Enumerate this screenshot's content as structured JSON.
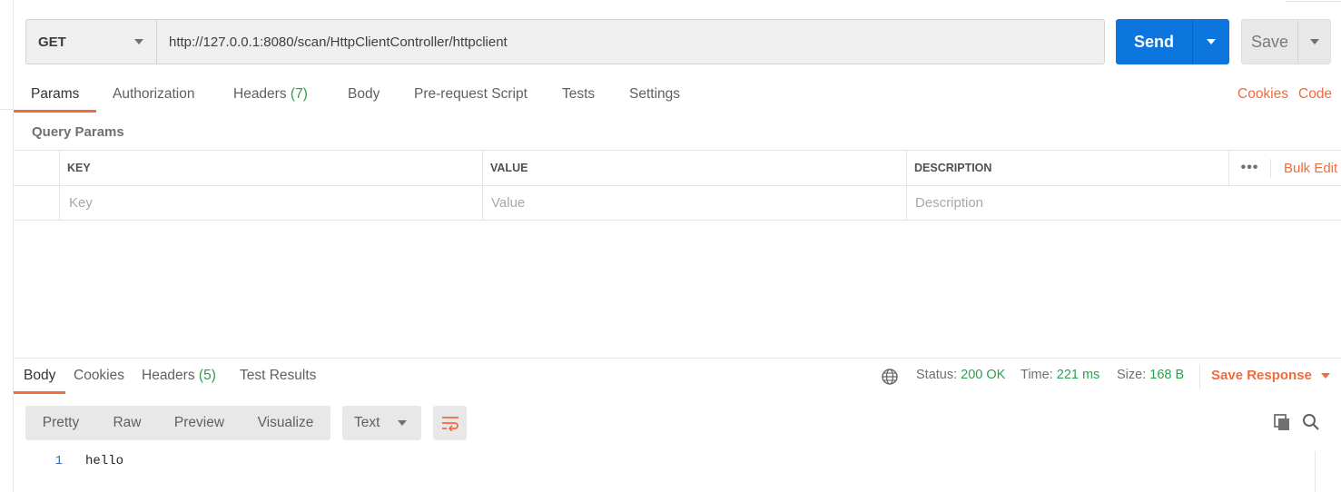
{
  "request": {
    "method": "GET",
    "url": "http://127.0.0.1:8080/scan/HttpClientController/httpclient",
    "send_label": "Send",
    "save_label": "Save"
  },
  "request_tabs": {
    "params": "Params",
    "authorization": "Authorization",
    "headers": "Headers",
    "headers_count": "(7)",
    "body": "Body",
    "prerequest": "Pre-request Script",
    "tests": "Tests",
    "settings": "Settings",
    "cookies_link": "Cookies",
    "code_link": "Code"
  },
  "query_params": {
    "title": "Query Params",
    "columns": [
      "KEY",
      "VALUE",
      "DESCRIPTION"
    ],
    "more_label": "•••",
    "bulk_edit": "Bulk Edit",
    "placeholders": [
      "Key",
      "Value",
      "Description"
    ]
  },
  "response": {
    "tabs": {
      "body": "Body",
      "cookies": "Cookies",
      "headers": "Headers",
      "headers_count": "(5)",
      "test_results": "Test Results"
    },
    "status_label": "Status:",
    "status_value": "200 OK",
    "time_label": "Time:",
    "time_value": "221 ms",
    "size_label": "Size:",
    "size_value": "168 B",
    "save_response": "Save Response",
    "views": [
      "Pretty",
      "Raw",
      "Preview",
      "Visualize"
    ],
    "format": "Text",
    "lines": [
      {
        "no": "1",
        "text": "hello"
      }
    ]
  },
  "icons": {
    "globe": "globe-icon",
    "wrap": "word-wrap-icon",
    "copy": "copy-icon",
    "search": "search-icon"
  },
  "colors": {
    "accent": "#f26b3a",
    "primary": "#0d76de",
    "success": "#2e9e4f"
  }
}
